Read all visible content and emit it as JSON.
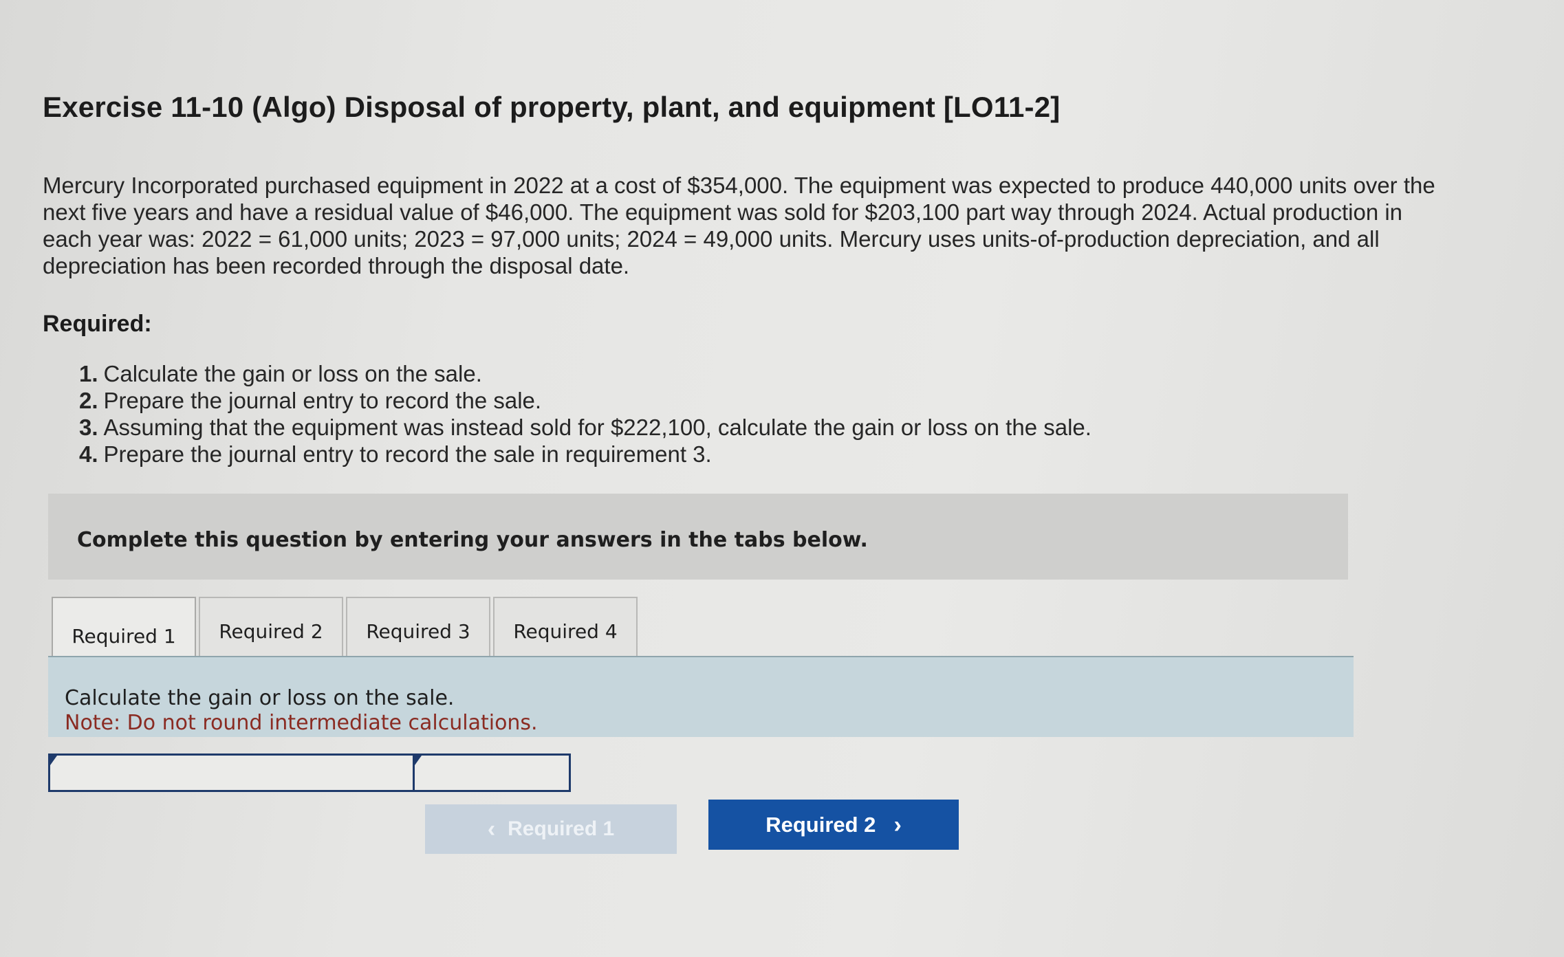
{
  "header": {
    "title": "Exercise 11-10 (Algo) Disposal of property, plant, and equipment [LO11-2]"
  },
  "problem": {
    "intro": "Mercury Incorporated purchased equipment in 2022 at a cost of $354,000. The equipment was expected to produce 440,000 units over the next five years and have a residual value of $46,000. The equipment was sold for $203,100 part way through 2024. Actual production in each year was: 2022 = 61,000 units; 2023 = 97,000 units; 2024 = 49,000 units. Mercury uses units-of-production depreciation, and all depreciation has been recorded through the disposal date.",
    "required_heading": "Required:",
    "requirements": [
      {
        "num": "1.",
        "text": "Calculate the gain or loss on the sale."
      },
      {
        "num": "2.",
        "text": "Prepare the journal entry to record the sale."
      },
      {
        "num": "3.",
        "text": "Assuming that the equipment was instead sold for $222,100, calculate the gain or loss on the sale."
      },
      {
        "num": "4.",
        "text": "Prepare the journal entry to record the sale in requirement 3."
      }
    ]
  },
  "instruction": {
    "text": "Complete this question by entering your answers in the tabs below."
  },
  "tabs": [
    {
      "label": "Required 1",
      "active": true
    },
    {
      "label": "Required 2",
      "active": false
    },
    {
      "label": "Required 3",
      "active": false
    },
    {
      "label": "Required 4",
      "active": false
    }
  ],
  "panel": {
    "prompt": "Calculate the gain or loss on the sale.",
    "note": "Note: Do not round intermediate calculations."
  },
  "answer": {
    "label_value": "",
    "amount_value": ""
  },
  "navigation": {
    "prev_label": "Required 1",
    "next_label": "Required 2",
    "prev_icon": "chevron-left-icon",
    "next_icon": "chevron-right-icon"
  },
  "colors": {
    "next_button": "#1552a3",
    "prev_button_disabled": "#c7d2dd",
    "panel_bg": "#c6d6dc",
    "note_text": "#8a2b22"
  }
}
